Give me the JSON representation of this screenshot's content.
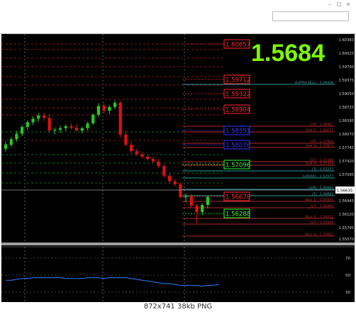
{
  "window": {
    "controls": [
      "–",
      "□",
      "×"
    ]
  },
  "big_price": "1.5684",
  "caption": "872x741  38kb  PNG",
  "colors": {
    "bull": "#22cc22",
    "bear": "#e01010",
    "background": "#000000",
    "big_price": "#7cfc00"
  },
  "price_boxes": [
    {
      "label": "1.60657",
      "color": "#ff2a2a"
    },
    {
      "label": "1.59712",
      "color": "#ff2a2a"
    },
    {
      "label": "1.59322",
      "color": "#ff2a2a"
    },
    {
      "label": "1.58904",
      "color": "#ff2a2a"
    },
    {
      "label": "1.58551",
      "color": "#3333ff"
    },
    {
      "label": "1.58076",
      "color": "#3333ff"
    },
    {
      "label": "1.57096",
      "color": "#33ff33"
    },
    {
      "label": "1.56678",
      "color": "#ff2a2a"
    },
    {
      "label": "1.56288",
      "color": "#33ff33"
    }
  ],
  "level_labels": [
    {
      "text": "(EXTRA SELL) - 1.59438",
      "color": "#3fa8a8"
    },
    {
      "text": "(ST) - 1.58467",
      "color": "#c03030"
    },
    {
      "text": "(Sell 2) - 1.58271",
      "color": "#c03030"
    },
    {
      "text": "(ST) - 1.57950",
      "color": "#c03030"
    },
    {
      "text": "(Sell 3) - 1.57873",
      "color": "#c03030"
    },
    {
      "text": "(ST) - 1.57439",
      "color": "#c03030"
    },
    {
      "text": "(Sell 1) - 1.57419",
      "color": "#c03030"
    },
    {
      "text": "(T) - 1.57277",
      "color": "#3fa8a8"
    },
    {
      "text": "(LOR/KF) - 1.57077",
      "color": "#3fa8a8"
    },
    {
      "text": "(S/R) - 1.56683",
      "color": "#3fa8a8"
    },
    {
      "text": "(T) - 1.56687",
      "color": "#3fa8a8"
    },
    {
      "text": "(Buy 1) - 1.56521",
      "color": "#c03030"
    },
    {
      "text": "(ST) - 1.56480",
      "color": "#c03030"
    },
    {
      "text": "(Buy 2) - 1.56072",
      "color": "#c03030"
    },
    {
      "text": "(ST) - 1.55989",
      "color": "#c03030"
    },
    {
      "text": "(Buy 3) - 1.55665",
      "color": "#c03030"
    }
  ],
  "price_axis_labels": [
    "1.60360",
    "1.60025",
    "1.59700",
    "1.59375",
    "1.59050",
    "1.58725",
    "1.58395",
    "1.58070",
    "1.57745",
    "1.57420",
    "1.57095",
    "1.56665",
    "1.56445",
    "1.56120",
    "1.55795",
    "1.55570"
  ],
  "current_price_tag": "1.56635",
  "indicator_axis_labels": [
    "70",
    "50",
    "30"
  ],
  "candles": [
    {
      "o": 1.579,
      "h": 1.5808,
      "l": 1.5783,
      "c": 1.5801
    },
    {
      "o": 1.58,
      "h": 1.582,
      "l": 1.5794,
      "c": 1.5814
    },
    {
      "o": 1.5814,
      "h": 1.5835,
      "l": 1.5808,
      "c": 1.5828
    },
    {
      "o": 1.5828,
      "h": 1.585,
      "l": 1.5822,
      "c": 1.5845
    },
    {
      "o": 1.5845,
      "h": 1.5862,
      "l": 1.5838,
      "c": 1.5857
    },
    {
      "o": 1.5857,
      "h": 1.5872,
      "l": 1.585,
      "c": 1.5866
    },
    {
      "o": 1.5866,
      "h": 1.588,
      "l": 1.5858,
      "c": 1.5874
    },
    {
      "o": 1.5874,
      "h": 1.5882,
      "l": 1.586,
      "c": 1.5868
    },
    {
      "o": 1.5868,
      "h": 1.5878,
      "l": 1.583,
      "c": 1.5836
    },
    {
      "o": 1.5836,
      "h": 1.5844,
      "l": 1.5826,
      "c": 1.5838
    },
    {
      "o": 1.5838,
      "h": 1.5848,
      "l": 1.583,
      "c": 1.5842
    },
    {
      "o": 1.5842,
      "h": 1.5852,
      "l": 1.5835,
      "c": 1.5847
    },
    {
      "o": 1.5847,
      "h": 1.5855,
      "l": 1.5838,
      "c": 1.5843
    },
    {
      "o": 1.5843,
      "h": 1.5852,
      "l": 1.5834,
      "c": 1.5836
    },
    {
      "o": 1.5836,
      "h": 1.5846,
      "l": 1.5829,
      "c": 1.5842
    },
    {
      "o": 1.5842,
      "h": 1.5858,
      "l": 1.5836,
      "c": 1.5854
    },
    {
      "o": 1.5854,
      "h": 1.588,
      "l": 1.585,
      "c": 1.5876
    },
    {
      "o": 1.5876,
      "h": 1.5905,
      "l": 1.587,
      "c": 1.5898
    },
    {
      "o": 1.5898,
      "h": 1.5906,
      "l": 1.588,
      "c": 1.5886
    },
    {
      "o": 1.5886,
      "h": 1.59,
      "l": 1.5878,
      "c": 1.5896
    },
    {
      "o": 1.5896,
      "h": 1.5912,
      "l": 1.589,
      "c": 1.5906
    },
    {
      "o": 1.5906,
      "h": 1.5912,
      "l": 1.5818,
      "c": 1.5826
    },
    {
      "o": 1.5826,
      "h": 1.5834,
      "l": 1.5796,
      "c": 1.58
    },
    {
      "o": 1.58,
      "h": 1.5808,
      "l": 1.5778,
      "c": 1.5784
    },
    {
      "o": 1.5784,
      "h": 1.579,
      "l": 1.5772,
      "c": 1.5776
    },
    {
      "o": 1.5776,
      "h": 1.5782,
      "l": 1.5766,
      "c": 1.577
    },
    {
      "o": 1.577,
      "h": 1.5776,
      "l": 1.576,
      "c": 1.5764
    },
    {
      "o": 1.5764,
      "h": 1.577,
      "l": 1.5754,
      "c": 1.5758
    },
    {
      "o": 1.5758,
      "h": 1.5764,
      "l": 1.5742,
      "c": 1.5746
    },
    {
      "o": 1.5746,
      "h": 1.5752,
      "l": 1.5716,
      "c": 1.5722
    },
    {
      "o": 1.5722,
      "h": 1.5728,
      "l": 1.5702,
      "c": 1.5708
    },
    {
      "o": 1.5708,
      "h": 1.5714,
      "l": 1.5694,
      "c": 1.57
    },
    {
      "o": 1.57,
      "h": 1.5705,
      "l": 1.5664,
      "c": 1.5668
    },
    {
      "o": 1.5668,
      "h": 1.5676,
      "l": 1.5654,
      "c": 1.567
    },
    {
      "o": 1.567,
      "h": 1.5676,
      "l": 1.564,
      "c": 1.5646
    },
    {
      "o": 1.5646,
      "h": 1.5652,
      "l": 1.5602,
      "c": 1.563
    },
    {
      "o": 1.563,
      "h": 1.5652,
      "l": 1.5622,
      "c": 1.5648
    },
    {
      "o": 1.5648,
      "h": 1.5672,
      "l": 1.564,
      "c": 1.5668
    }
  ],
  "indicator_values": [
    44,
    44,
    45,
    46,
    46,
    47,
    47,
    47,
    47,
    47,
    47,
    46,
    46,
    46,
    46,
    47,
    47,
    47,
    46,
    47,
    47,
    47,
    47,
    46,
    45,
    44,
    43,
    42,
    41,
    40,
    40,
    39,
    38,
    38,
    38,
    38,
    37,
    38,
    38,
    39
  ]
}
